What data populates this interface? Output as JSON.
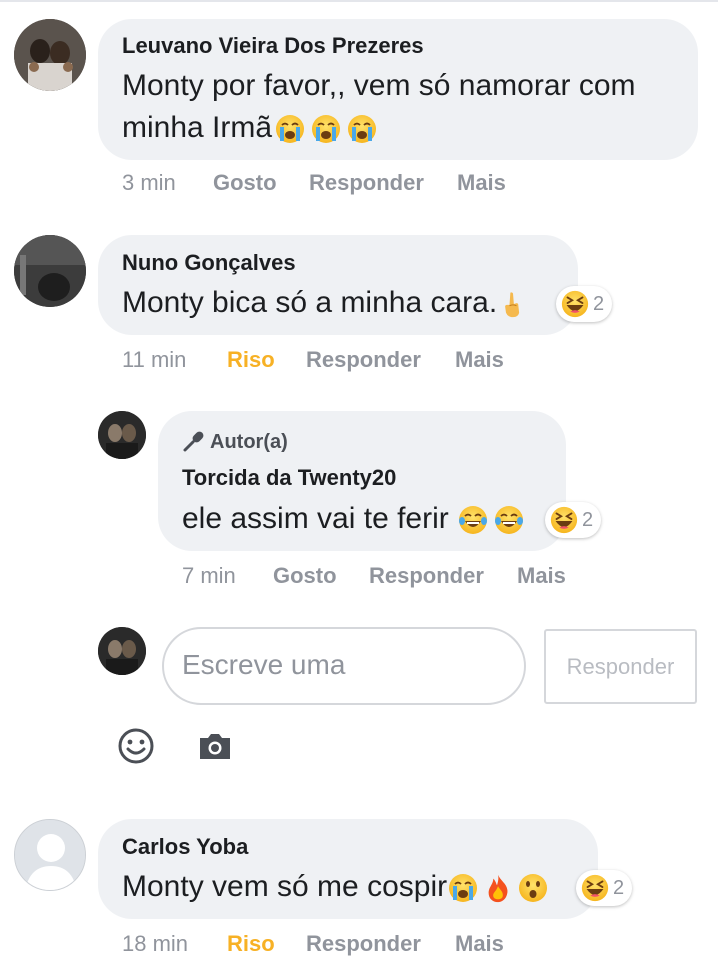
{
  "comments": [
    {
      "author": "Leuvano Vieira Dos Prezeres",
      "text_line1": "Monty por favor,, vem só namorar com",
      "text_line2": "minha Irmã",
      "emojis": [
        "loudly-crying-face",
        "loudly-crying-face",
        "loudly-crying-face"
      ],
      "time": "3 min",
      "like": "Gosto",
      "reply": "Responder",
      "more": "Mais"
    },
    {
      "author": "Nuno Gonçalves",
      "text": "Monty bica só a minha cara.",
      "emojis": [
        "hand-gesture"
      ],
      "reaction_count": "2",
      "reaction_icon": "haha-icon",
      "time": "11 min",
      "like": "Riso",
      "reply": "Responder",
      "more": "Mais"
    },
    {
      "badge": "Autor(a)",
      "badge_icon": "microphone-icon",
      "author": "Torcida da Twenty20",
      "text": "ele assim vai te ferir",
      "emojis": [
        "tears-of-joy-face",
        "tears-of-joy-face"
      ],
      "reaction_count": "2",
      "reaction_icon": "haha-icon",
      "time": "7 min",
      "like": "Gosto",
      "reply": "Responder",
      "more": "Mais"
    },
    {
      "author": "Carlos Yoba",
      "text": "Monty vem só me cospir",
      "emojis": [
        "loudly-crying-face",
        "fire",
        "hushed-face"
      ],
      "reaction_count": "2",
      "reaction_icon": "haha-icon",
      "time": "18 min",
      "like": "Riso",
      "reply": "Responder",
      "more": "Mais"
    }
  ],
  "reply_box": {
    "placeholder": "Escreve uma",
    "submit_label": "Responder",
    "icons": [
      "emoji-icon",
      "camera-icon"
    ]
  },
  "colors": {
    "bubble": "#eff1f4",
    "meta_gray": "#90949c",
    "riso": "#f7b125",
    "text": "#1c1e21"
  }
}
